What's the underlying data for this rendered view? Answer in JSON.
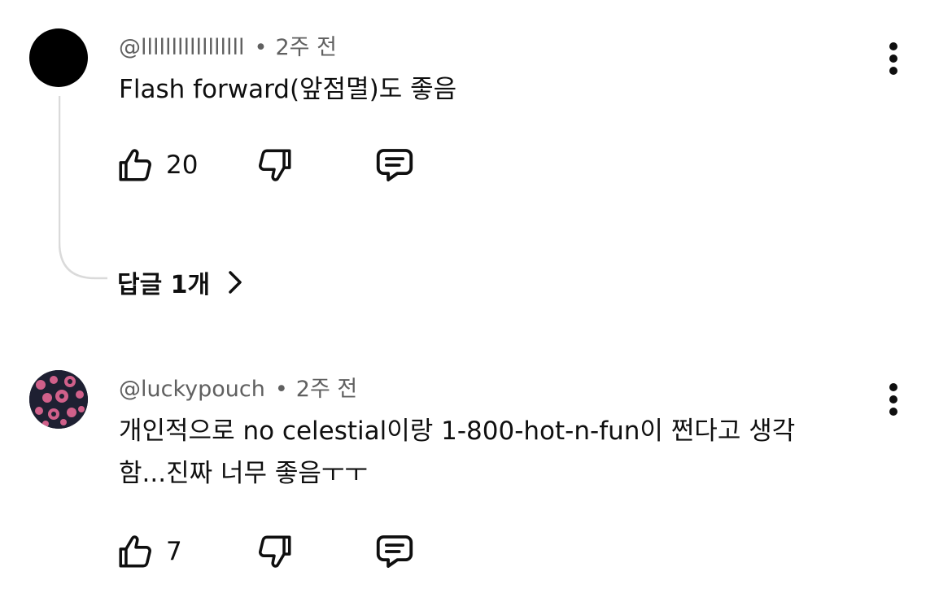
{
  "comments": [
    {
      "author": "@lllllllllllllllll",
      "separator": "•",
      "time": "2주 전",
      "text": "Flash forward(앞점멸)도 좋음",
      "likes": "20",
      "replies_label": "답글 1개",
      "avatar_color": "#000000"
    },
    {
      "author": "@luckypouch",
      "separator": "•",
      "time": "2주 전",
      "text_line1": "개인적으로 no celestial이랑 1-800-hot-n-fun이 쩐다고 생각",
      "text_line2": "함...진짜 너무 좋음ㅜㅜ",
      "likes": "7",
      "avatar_color": "#1e2032"
    }
  ],
  "icons": {
    "like": "thumb-up-icon",
    "dislike": "thumb-down-icon",
    "reply": "comment-icon",
    "more": "more-vertical-icon",
    "chevron": "chevron-right-icon"
  },
  "colors": {
    "text": "#0f0f0f",
    "meta": "#606060",
    "thread_line": "#dadada",
    "avatar_pattern_pink": "#d0608a"
  }
}
